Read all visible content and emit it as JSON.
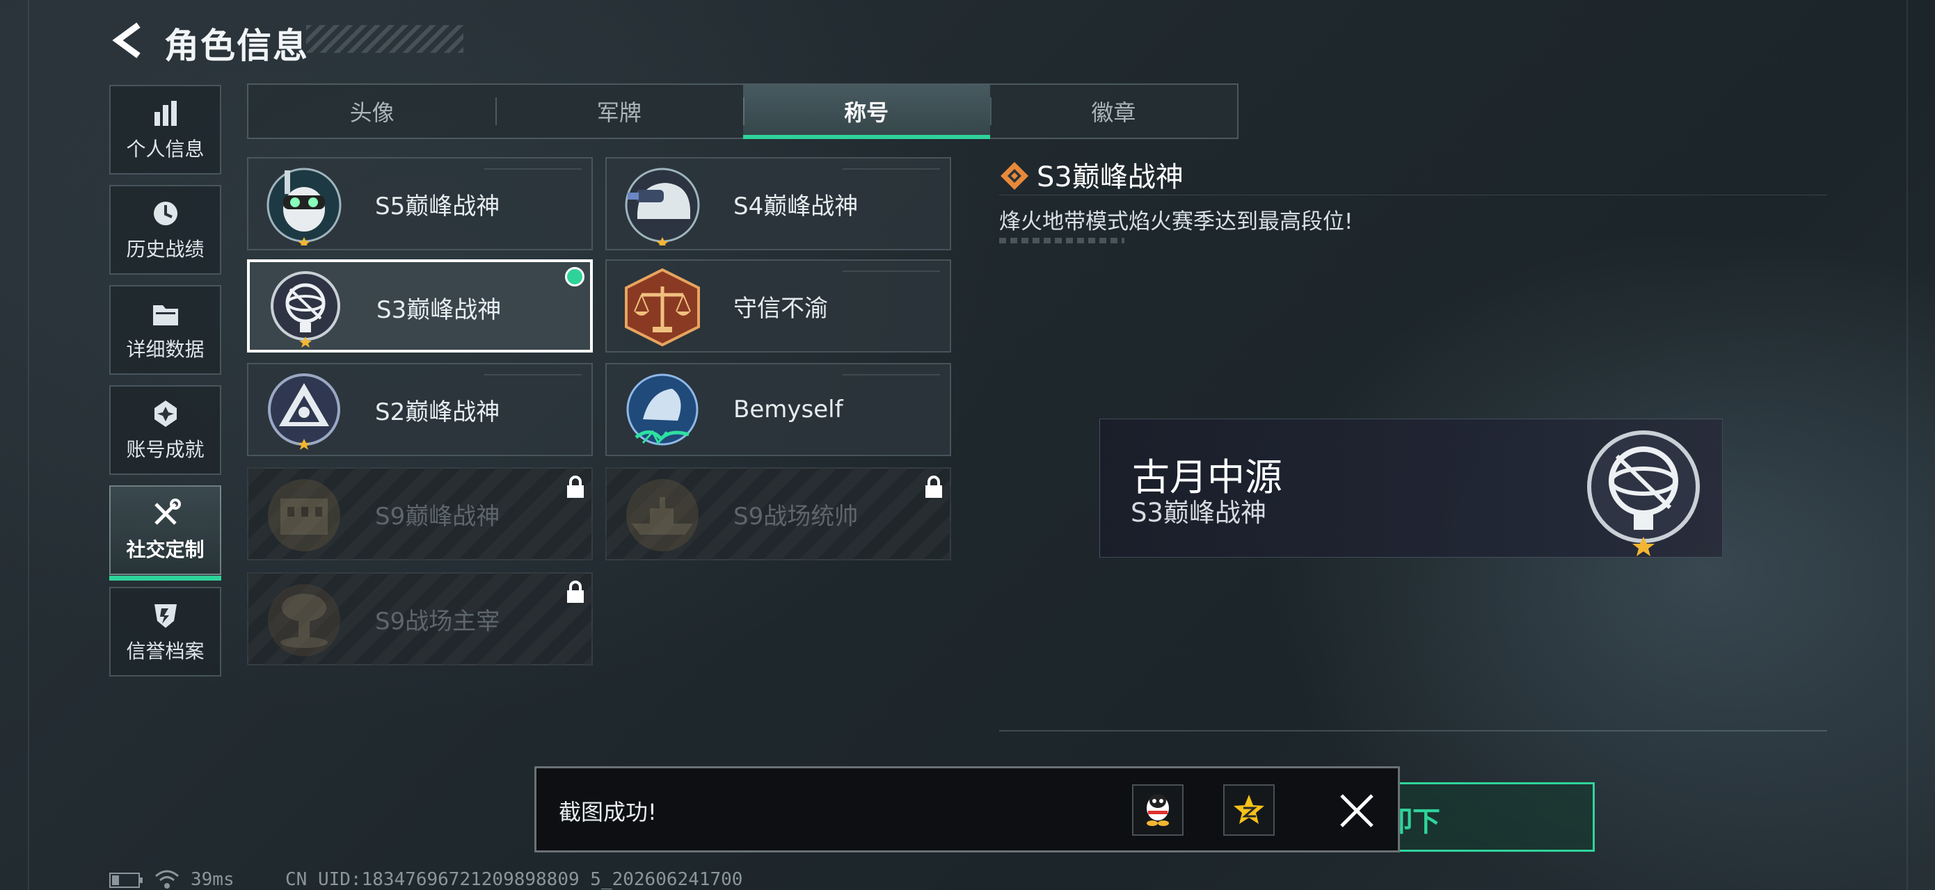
{
  "header": {
    "title": "角色信息"
  },
  "sidebar": {
    "items": [
      {
        "label": "个人信息",
        "icon": "bar-chart-icon"
      },
      {
        "label": "历史战绩",
        "icon": "clock-icon"
      },
      {
        "label": "详细数据",
        "icon": "folder-icon"
      },
      {
        "label": "账号成就",
        "icon": "achievement-icon"
      },
      {
        "label": "社交定制",
        "icon": "tools-icon",
        "active": true
      },
      {
        "label": "信誉档案",
        "icon": "shield-icon"
      }
    ]
  },
  "tabs": [
    {
      "label": "头像"
    },
    {
      "label": "军牌"
    },
    {
      "label": "称号",
      "active": true
    },
    {
      "label": "徽章"
    }
  ],
  "titles": [
    {
      "name": "S5巅峰战神",
      "emblem": "skull-diver-emblem",
      "locked": false
    },
    {
      "name": "S4巅峰战神",
      "emblem": "helmet-emblem",
      "locked": false
    },
    {
      "name": "S3巅峰战神",
      "emblem": "armillary-sphere-emblem",
      "locked": false,
      "selected": true
    },
    {
      "name": "守信不渝",
      "emblem": "scales-emblem",
      "locked": false
    },
    {
      "name": "S2巅峰战神",
      "emblem": "triangle-eye-emblem",
      "locked": false
    },
    {
      "name": "Bemyself",
      "emblem": "graffiti-emblem",
      "locked": false
    },
    {
      "name": "S9巅峰战神",
      "emblem": "building-emblem",
      "locked": true
    },
    {
      "name": "S9战场统帅",
      "emblem": "warship-emblem",
      "locked": true
    },
    {
      "name": "S9战场主宰",
      "emblem": "mushroom-cloud-emblem",
      "locked": true
    }
  ],
  "detail": {
    "title": "S3巅峰战神",
    "description": "烽火地带模式焰火赛季达到最高段位!"
  },
  "nameplate": {
    "player_name": "古月中源",
    "title": "S3巅峰战神"
  },
  "toast": {
    "message": "截图成功!",
    "share_qq": "qq-icon",
    "share_qzone": "qzone-star-icon"
  },
  "action_button": {
    "label": "卸下"
  },
  "status": {
    "ping": "39ms",
    "uid": "CN UID:18347696721209898809 5_202606241700"
  },
  "colors": {
    "accent": "#2fd39a",
    "selected_border": "#ffffff"
  }
}
